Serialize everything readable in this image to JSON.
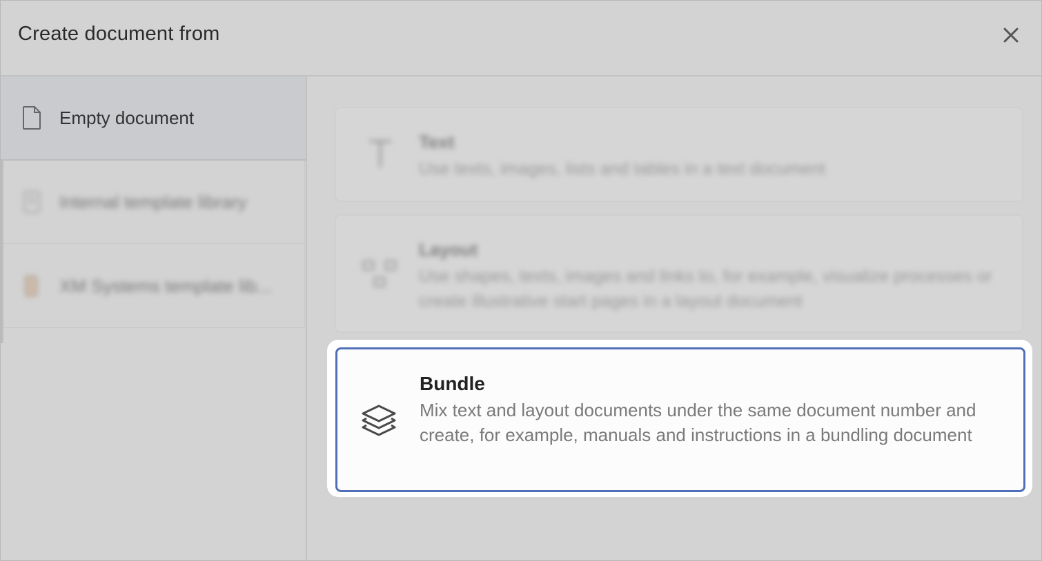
{
  "dialog": {
    "title": "Create document from",
    "close_icon": "close-icon"
  },
  "sidebar": {
    "items": [
      {
        "label": "Empty document",
        "icon": "document-icon",
        "active": true
      },
      {
        "label": "Internal template library",
        "icon": "library-icon",
        "active": false
      },
      {
        "label": "XM Systems template lib...",
        "icon": "template-icon",
        "active": false
      }
    ]
  },
  "options": [
    {
      "title": "Text",
      "description": "Use texts, images, lists and tables in a text document",
      "icon": "text-icon"
    },
    {
      "title": "Layout",
      "description": "Use shapes, texts, images and links to, for example, visualize processes or create illustrative start pages in a layout document",
      "icon": "layout-icon"
    },
    {
      "title": "Bundle",
      "description": "Mix text and layout documents under the same document number and create, for example, manuals and instructions in a bundling document",
      "icon": "layers-icon",
      "highlighted": true
    }
  ],
  "colors": {
    "accent": "#4f6fb8",
    "overlay": "#d3d3d3"
  }
}
